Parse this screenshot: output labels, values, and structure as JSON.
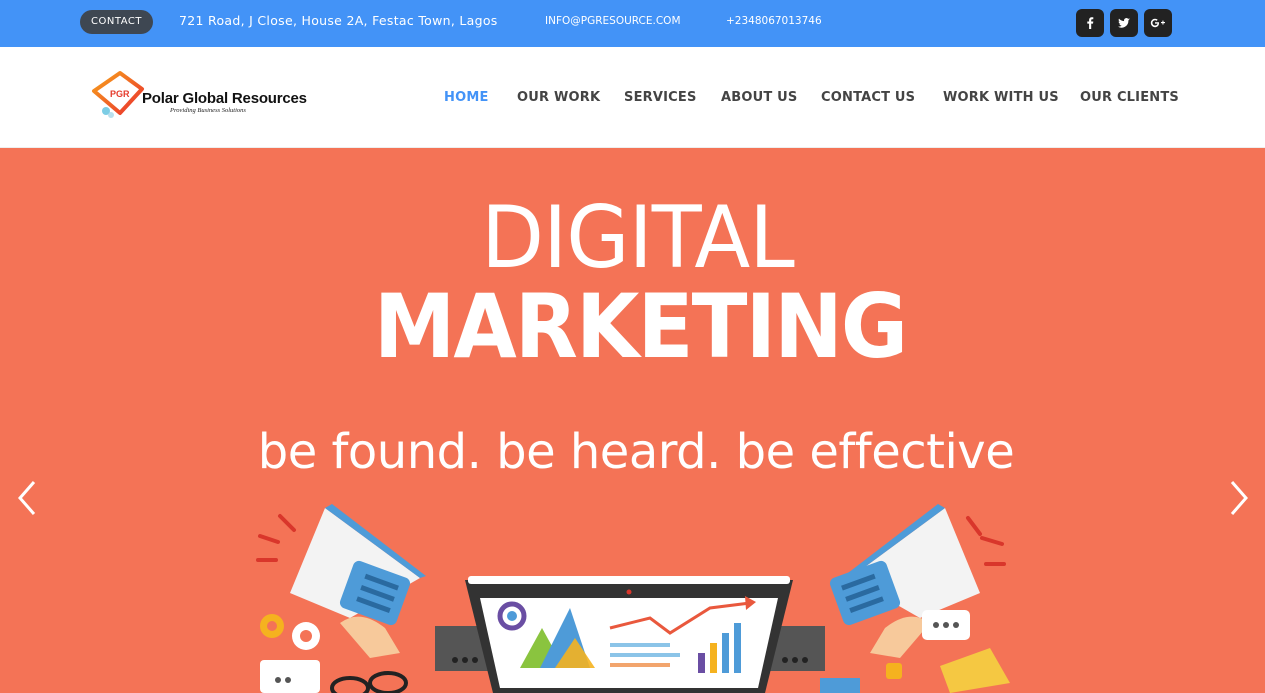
{
  "topbar": {
    "contact_label": "CONTACT",
    "address": "721 Road, J Close, House 2A, Festac Town, Lagos",
    "email": "INFO@PGRESOURCE.COM",
    "phone": "+2348067013746",
    "social": [
      {
        "name": "facebook",
        "icon": "f"
      },
      {
        "name": "twitter",
        "icon": "twitter-bird"
      },
      {
        "name": "google-plus",
        "icon": "G+"
      }
    ],
    "bg_color": "#4393f7"
  },
  "header": {
    "logo_mark": "PGR",
    "logo_title": "Polar Global Resources",
    "logo_subtitle": "Providing Business Solutions",
    "nav": [
      {
        "label": "HOME",
        "active": true
      },
      {
        "label": "OUR WORK",
        "active": false
      },
      {
        "label": "SERVICES",
        "active": false
      },
      {
        "label": "ABOUT US",
        "active": false
      },
      {
        "label": "CONTACT US",
        "active": false
      },
      {
        "label": "WORK WITH US",
        "active": false
      },
      {
        "label": "OUR CLIENTS",
        "active": false
      }
    ],
    "active_color": "#4393f7"
  },
  "hero": {
    "line1": "DIGITAL",
    "line2": "MARKETING",
    "tagline": "be found. be heard. be effective",
    "bg_color": "#f47356",
    "prev_icon": "chevron-left-icon",
    "next_icon": "chevron-right-icon"
  }
}
